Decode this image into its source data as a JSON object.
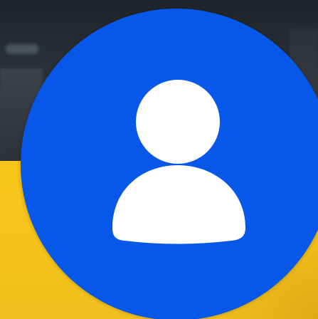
{
  "avatar": {
    "icon": "user-icon",
    "color": "#0757e8",
    "icon_color": "#ffffff"
  },
  "background": {
    "top_color": "#2a2f36",
    "bottom_color": "#f5c31a"
  }
}
